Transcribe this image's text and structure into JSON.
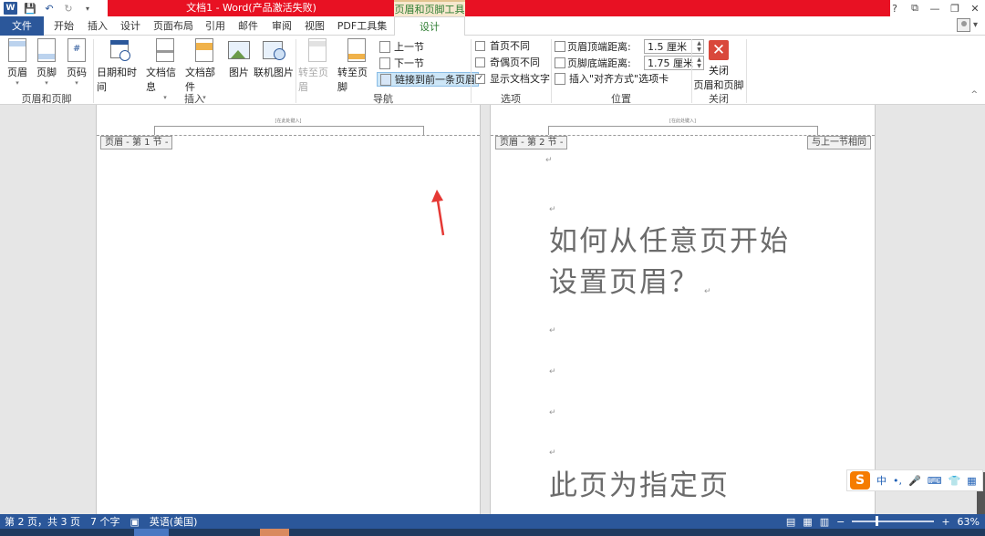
{
  "window": {
    "title": "文档1 - Word(产品激活失败)",
    "context_title": "页眉和页脚工具",
    "controls": [
      "?",
      "⧉",
      "—",
      "❐",
      "✕"
    ],
    "user_caret": "▾"
  },
  "qat": {
    "app_icon": "W",
    "save": "💾",
    "undo": "↶",
    "redo": "↻",
    "customize": "▾"
  },
  "tabs": {
    "file": "文件",
    "items": [
      "开始",
      "插入",
      "设计",
      "页面布局",
      "引用",
      "邮件",
      "审阅",
      "视图",
      "PDF工具集"
    ],
    "active": "设计"
  },
  "ribbon": {
    "groups": {
      "header_footer": {
        "label": "页眉和页脚",
        "header": "页眉",
        "footer": "页脚",
        "page_number": "页码"
      },
      "insert": {
        "label": "插入",
        "datetime": "日期和时间",
        "docinfo": "文档信息",
        "quickparts": "文档部件",
        "picture": "图片",
        "online_picture": "联机图片"
      },
      "navigation": {
        "label": "导航",
        "goto_header": "转至页眉",
        "goto_footer": "转至页脚",
        "previous": "上一节",
        "next": "下一节",
        "link_previous": "链接到前一条页眉"
      },
      "options": {
        "label": "选项",
        "different_first": "首页不同",
        "different_odd_even": "奇偶页不同",
        "show_text": "显示文档文字",
        "different_first_checked": false,
        "different_odd_even_checked": false,
        "show_text_checked": true
      },
      "position": {
        "label": "位置",
        "header_from_top": "页眉顶端距离:",
        "header_from_top_value": "1.5 厘米",
        "footer_from_bottom": "页脚底端距离:",
        "footer_from_bottom_value": "1.75 厘米",
        "insert_alignment_tab": "插入\"对齐方式\"选项卡"
      },
      "close": {
        "label": "关闭",
        "close_button": "关闭\n页眉和页脚",
        "close_line1": "关闭",
        "close_line2": "页眉和页脚"
      }
    }
  },
  "document": {
    "page1": {
      "type_here": "[在此处键入]",
      "header_tag": "页眉 - 第 1 节 -"
    },
    "page2": {
      "type_here": "[在此处键入]",
      "header_tag": "页眉 - 第 2 节 -",
      "same_as_previous": "与上一节相同",
      "heading_line1": "如何从任意页开始",
      "heading_line2": "设置页眉？",
      "body_text": "此页为指定页",
      "para_mark": "↵"
    }
  },
  "ime": {
    "logo": "S",
    "items": [
      "中",
      "•,",
      "🎤",
      "⌨",
      "👕",
      "▦"
    ]
  },
  "status": {
    "page": "第 2 页，共 3 页",
    "words": "7 个字",
    "language": "英语(美国)",
    "zoom": "63%",
    "zoom_fraction": 0.63
  },
  "colors": {
    "accent": "#2b579a",
    "title_red": "#e81123",
    "context_green": "#2e7d32",
    "arrow_red": "#e53935"
  }
}
